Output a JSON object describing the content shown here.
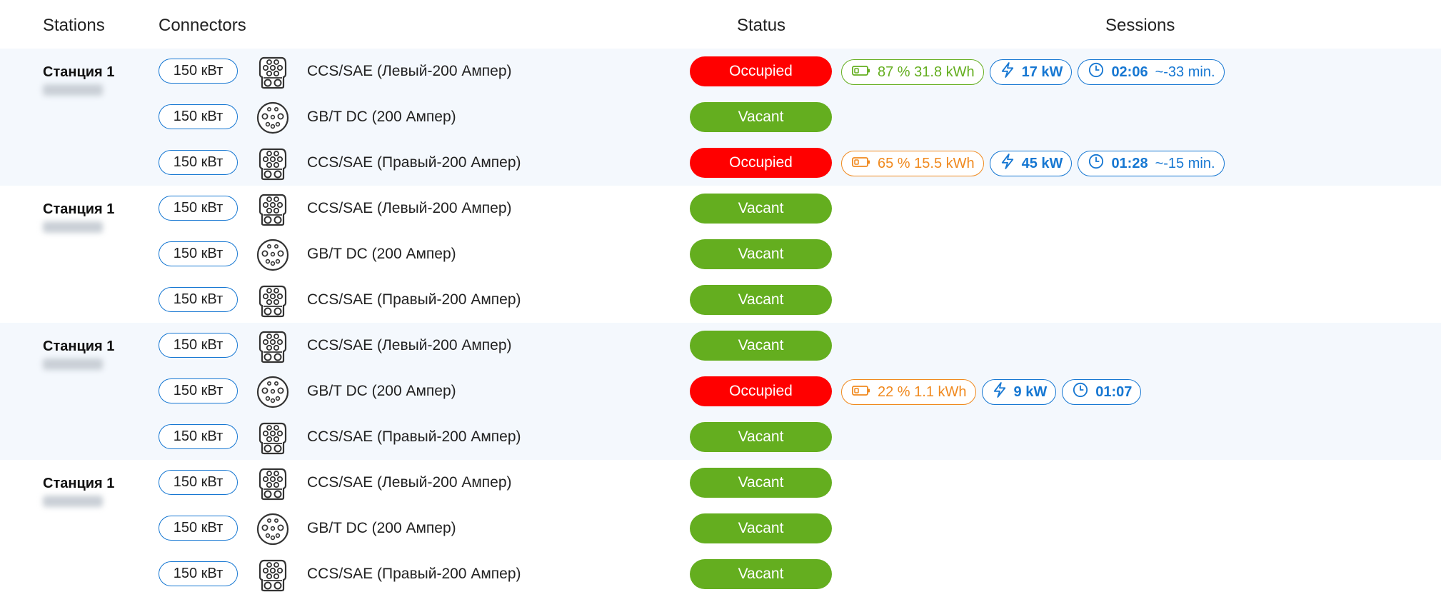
{
  "header": {
    "stations": "Stations",
    "connectors": "Connectors",
    "status": "Status",
    "sessions": "Sessions"
  },
  "colors": {
    "occupied": "#ff0000",
    "vacant": "#64ae1f",
    "accent_blue": "#1677d2",
    "battery_green": "#64ae1f",
    "battery_orange": "#f0891e",
    "shaded_row": "#f4f8fd"
  },
  "stations": [
    {
      "name": "Станция 1",
      "connectors": [
        {
          "power": "150 кВт",
          "icon": "ccs-connector-icon",
          "name": "CCS/SAE (Левый-200 Ампер)",
          "status": "Occupied",
          "session": {
            "battery_color": "green",
            "battery": "87 % 31.8 kWh",
            "power": "17 kW",
            "time": "02:06",
            "remaining": "~-33 min."
          }
        },
        {
          "power": "150 кВт",
          "icon": "gbt-connector-icon",
          "name": "GB/T DC (200 Ампер)",
          "status": "Vacant"
        },
        {
          "power": "150 кВт",
          "icon": "ccs-connector-icon",
          "name": "CCS/SAE (Правый-200 Ампер)",
          "status": "Occupied",
          "session": {
            "battery_color": "orange",
            "battery": "65 % 15.5 kWh",
            "power": "45 kW",
            "time": "01:28",
            "remaining": "~-15 min."
          }
        }
      ]
    },
    {
      "name": "Станция 1",
      "connectors": [
        {
          "power": "150 кВт",
          "icon": "ccs-connector-icon",
          "name": "CCS/SAE (Левый-200 Ампер)",
          "status": "Vacant"
        },
        {
          "power": "150 кВт",
          "icon": "gbt-connector-icon",
          "name": "GB/T DC (200 Ампер)",
          "status": "Vacant"
        },
        {
          "power": "150 кВт",
          "icon": "ccs-connector-icon",
          "name": "CCS/SAE (Правый-200 Ампер)",
          "status": "Vacant"
        }
      ]
    },
    {
      "name": "Станция 1",
      "connectors": [
        {
          "power": "150 кВт",
          "icon": "ccs-connector-icon",
          "name": "CCS/SAE (Левый-200 Ампер)",
          "status": "Vacant"
        },
        {
          "power": "150 кВт",
          "icon": "gbt-connector-icon",
          "name": "GB/T DC (200 Ампер)",
          "status": "Occupied",
          "session": {
            "battery_color": "orange",
            "battery": "22 % 1.1 kWh",
            "power": "9 kW",
            "time": "01:07",
            "remaining": ""
          }
        },
        {
          "power": "150 кВт",
          "icon": "ccs-connector-icon",
          "name": "CCS/SAE (Правый-200 Ампер)",
          "status": "Vacant"
        }
      ]
    },
    {
      "name": "Станция 1",
      "connectors": [
        {
          "power": "150 кВт",
          "icon": "ccs-connector-icon",
          "name": "CCS/SAE (Левый-200 Ампер)",
          "status": "Vacant"
        },
        {
          "power": "150 кВт",
          "icon": "gbt-connector-icon",
          "name": "GB/T DC (200 Ампер)",
          "status": "Vacant"
        },
        {
          "power": "150 кВт",
          "icon": "ccs-connector-icon",
          "name": "CCS/SAE (Правый-200 Ампер)",
          "status": "Vacant"
        }
      ]
    }
  ]
}
